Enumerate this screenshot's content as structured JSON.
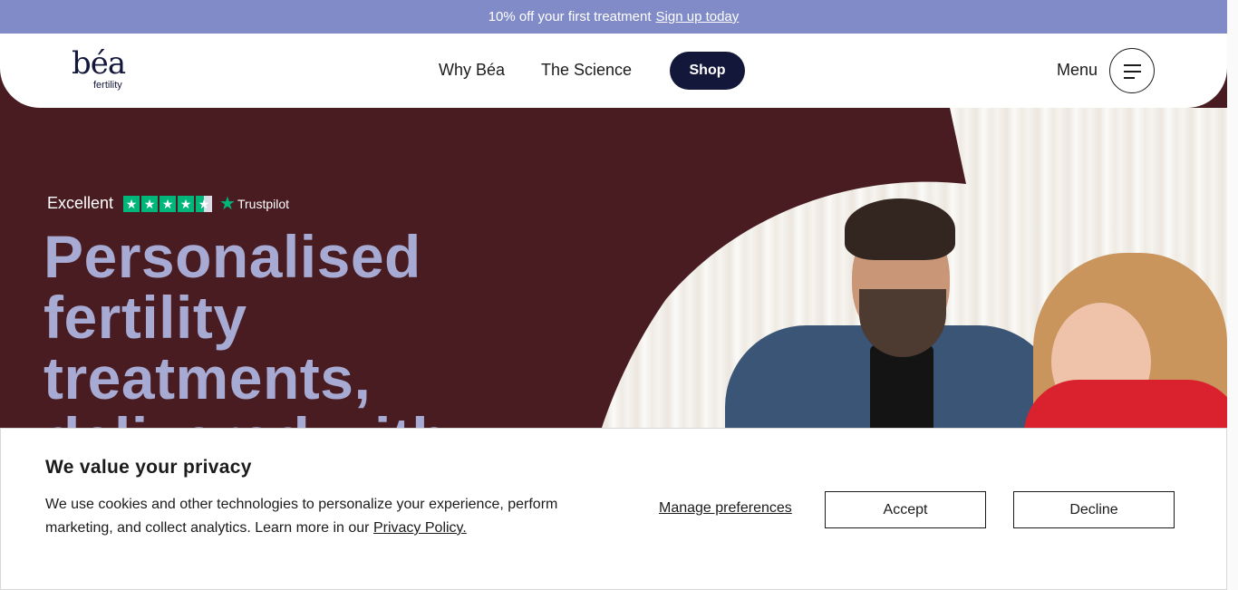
{
  "promo": {
    "text": "10% off your first treatment",
    "link": "Sign up today"
  },
  "header": {
    "logo_word": "béa",
    "logo_sub": "fertility",
    "nav": [
      "Why Béa",
      "The Science"
    ],
    "shop": "Shop",
    "menu_label": "Menu"
  },
  "hero": {
    "rating_word": "Excellent",
    "rating_brand": "Trustpilot",
    "title_lines": [
      "Personalised",
      "fertility",
      "treatments,",
      "delivered with"
    ]
  },
  "cookie": {
    "title": "We value your privacy",
    "body": "We use cookies and other technologies to personalize your experience, perform marketing, and collect analytics. Learn more in our",
    "policy_link": "Privacy Policy.",
    "manage": "Manage preferences",
    "accept": "Accept",
    "decline": "Decline"
  },
  "colors": {
    "promo_bg": "#818bc8",
    "hero_bg": "#481c20",
    "brand_navy": "#13183b",
    "hero_title": "#a7abd4",
    "trustpilot_green": "#00b67a"
  },
  "icons": [
    "trustpilot-star-icon",
    "hamburger-menu-icon"
  ]
}
